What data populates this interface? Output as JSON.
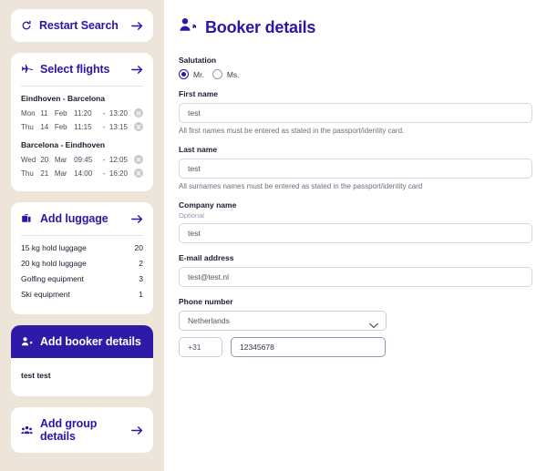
{
  "sidebar": {
    "restart": {
      "label": "Restart Search",
      "icon": "restart-icon",
      "arrow": "arrow-right-icon"
    },
    "flights": {
      "label": "Select flights",
      "icon": "plane-icon",
      "arrow": "arrow-right-icon",
      "routes": [
        {
          "title": "Eindhoven - Barcelona",
          "legs": [
            {
              "day": "Mon",
              "date": "11",
              "month": "Feb",
              "depart": "11:20",
              "dash": "-",
              "arrive": "13:20"
            },
            {
              "day": "Thu",
              "date": "14",
              "month": "Feb",
              "depart": "11:15",
              "dash": "-",
              "arrive": "13:15"
            }
          ]
        },
        {
          "title": "Barcelona - Eindhoven",
          "legs": [
            {
              "day": "Wed",
              "date": "20",
              "month": "Mar",
              "depart": "09:45",
              "dash": "-",
              "arrive": "12:05"
            },
            {
              "day": "Thu",
              "date": "21",
              "month": "Mar",
              "depart": "14:00",
              "dash": "-",
              "arrive": "16:20"
            }
          ]
        }
      ]
    },
    "luggage": {
      "label": "Add luggage",
      "icon": "suitcase-icon",
      "arrow": "arrow-right-icon",
      "items": [
        {
          "label": "15 kg hold luggage",
          "qty": "20"
        },
        {
          "label": "20 kg hold luggage",
          "qty": "2"
        },
        {
          "label": "Golfing equipment",
          "qty": "3"
        },
        {
          "label": "Ski equipment",
          "qty": "1"
        }
      ]
    },
    "booker": {
      "label": "Add booker details",
      "icon": "person-add-icon",
      "name": "test test",
      "active": true
    },
    "group": {
      "label": "Add group details",
      "icon": "group-icon",
      "arrow": "arrow-right-icon"
    }
  },
  "main": {
    "title": "Booker details",
    "title_icon": "person-add-icon",
    "salutation": {
      "label": "Salutation",
      "options": [
        {
          "label": "Mr.",
          "selected": true
        },
        {
          "label": "Ms.",
          "selected": false
        }
      ]
    },
    "first_name": {
      "label": "First name",
      "value": "test",
      "help": "All first names must be entered as stated in the passport/identity card."
    },
    "last_name": {
      "label": "Last name",
      "value": "test",
      "help": "All surnames names must be entered as stated in the passport/identity card"
    },
    "company_name": {
      "label": "Company name",
      "optional": "Optional",
      "value": "test"
    },
    "email": {
      "label": "E-mail address",
      "value": "test@test.nl"
    },
    "phone": {
      "label": "Phone number",
      "country": "Netherlands",
      "country_icon": "chevron-down-icon",
      "prefix": "+31",
      "number": "12345678"
    }
  },
  "colors": {
    "brand_purple": "#2A17A7",
    "active_panel": "#2D1BA8",
    "sidebar_bg": "#EDE4DA",
    "border": "#D3D7E3"
  }
}
